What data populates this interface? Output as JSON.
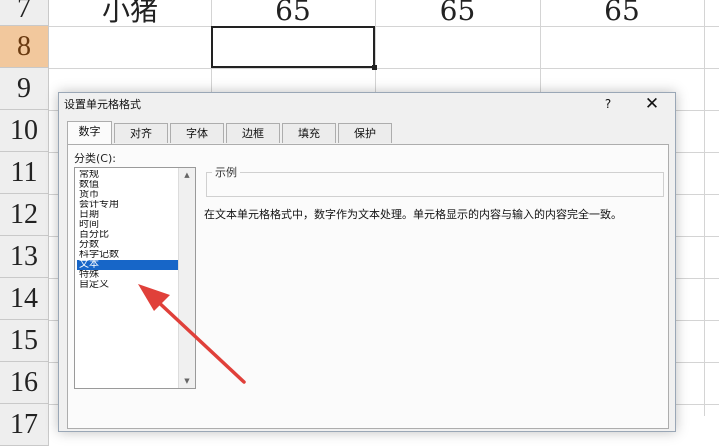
{
  "sheet": {
    "rows": [
      {
        "num": "7",
        "cells": [
          "小猪",
          "65",
          "65",
          "65"
        ]
      },
      {
        "num": "8",
        "cells": [
          "",
          "",
          "",
          ""
        ]
      },
      {
        "num": "9",
        "cells": [
          "",
          "",
          "",
          ""
        ]
      },
      {
        "num": "10",
        "cells": [
          "",
          "",
          "",
          ""
        ]
      },
      {
        "num": "11",
        "cells": [
          "",
          "",
          "",
          ""
        ]
      },
      {
        "num": "12",
        "cells": [
          "",
          "",
          "",
          ""
        ]
      },
      {
        "num": "13",
        "cells": [
          "",
          "",
          "",
          ""
        ]
      },
      {
        "num": "14",
        "cells": [
          "",
          "",
          "",
          ""
        ]
      },
      {
        "num": "15",
        "cells": [
          "",
          "",
          "",
          ""
        ]
      },
      {
        "num": "16",
        "cells": [
          "",
          "",
          "",
          ""
        ]
      },
      {
        "num": "17",
        "cells": [
          "",
          "",
          "",
          ""
        ]
      }
    ],
    "active_row": "8"
  },
  "dialog": {
    "title": "设置单元格格式",
    "help": "?",
    "close": "✕",
    "tabs": [
      {
        "label": "数字"
      },
      {
        "label": "对齐"
      },
      {
        "label": "字体"
      },
      {
        "label": "边框"
      },
      {
        "label": "填充"
      },
      {
        "label": "保护"
      }
    ],
    "active_tab": "数字",
    "category_label": "分类(C):",
    "categories": [
      {
        "label": "常规"
      },
      {
        "label": "数值"
      },
      {
        "label": "货币"
      },
      {
        "label": "会计专用"
      },
      {
        "label": "日期"
      },
      {
        "label": "时间"
      },
      {
        "label": "百分比"
      },
      {
        "label": "分数"
      },
      {
        "label": "科学记数"
      },
      {
        "label": "文本"
      },
      {
        "label": "特殊"
      },
      {
        "label": "自定义"
      }
    ],
    "selected_category": "文本",
    "sample_label": "示例",
    "description": "在文本单元格格式中，数字作为文本处理。单元格显示的内容与输入的内容完全一致。"
  },
  "colors": {
    "selection": "#1766c8",
    "annotation_arrow": "#e0403a",
    "active_row_header": "#f2c89d"
  },
  "icons": {
    "scroll_up": "scroll-up-arrow-icon",
    "scroll_down": "scroll-down-arrow-icon",
    "annotation": "red-arrow-annotation"
  }
}
